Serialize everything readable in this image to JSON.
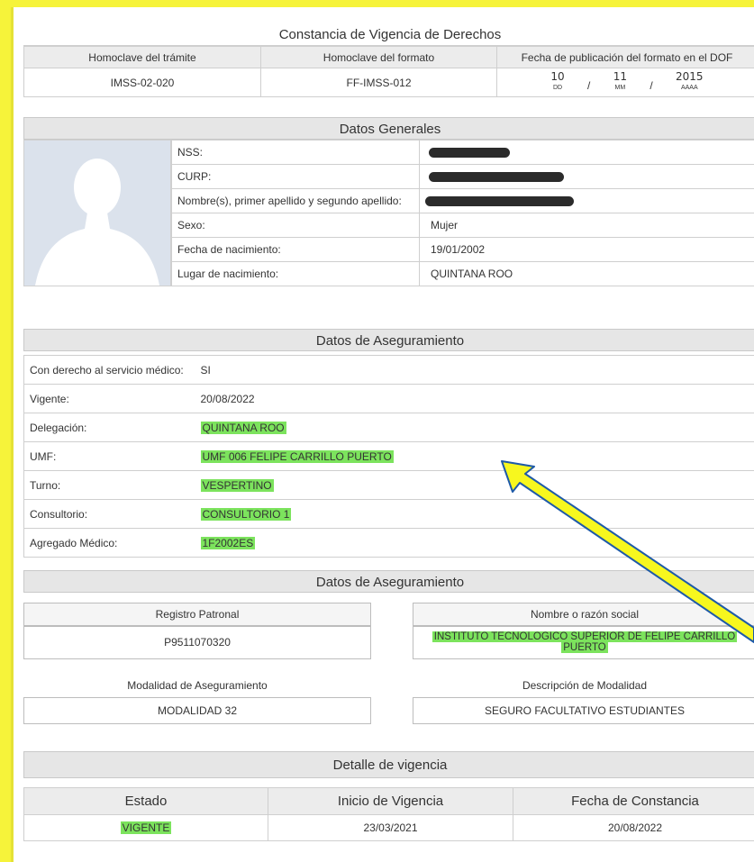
{
  "title": "Constancia de Vigencia de Derechos",
  "tramite": {
    "headers": [
      "Homoclave del trámite",
      "Homoclave del formato",
      "Fecha de publicación del formato en el DOF"
    ],
    "homoclave_tramite": "IMSS-02-020",
    "homoclave_formato": "FF-IMSS-012",
    "fecha": {
      "dd": "10",
      "mm": "11",
      "aaaa": "2015",
      "sep": "/",
      "dd_label": "DD",
      "mm_label": "MM",
      "aaaa_label": "AAAA"
    }
  },
  "datos_generales": {
    "title": "Datos Generales",
    "rows": [
      {
        "label": "NSS:",
        "value": "",
        "redacted": true
      },
      {
        "label": "CURP:",
        "value": "",
        "redacted": true
      },
      {
        "label": "Nombre(s), primer apellido y segundo apellido:",
        "value": "",
        "redacted": true
      },
      {
        "label": "Sexo:",
        "value": "Mujer"
      },
      {
        "label": "Fecha de nacimiento:",
        "value": "19/01/2002"
      },
      {
        "label": "Lugar de nacimiento:",
        "value": "QUINTANA ROO"
      }
    ]
  },
  "aseguramiento": {
    "title": "Datos de Aseguramiento",
    "rows": [
      {
        "label": "Con derecho al servicio médico:",
        "value": "SI",
        "highlight": false
      },
      {
        "label": "Vigente:",
        "value": "20/08/2022",
        "highlight": false
      },
      {
        "label": "Delegación:",
        "value": "QUINTANA ROO",
        "highlight": true
      },
      {
        "label": "UMF:",
        "value": "UMF 006 FELIPE CARRILLO PUERTO",
        "highlight": true
      },
      {
        "label": "Turno:",
        "value": "VESPERTINO",
        "highlight": true
      },
      {
        "label": "Consultorio:",
        "value": "CONSULTORIO 1",
        "highlight": true
      },
      {
        "label": "Agregado Médico:",
        "value": "1F2002ES",
        "highlight": true
      }
    ]
  },
  "patronal": {
    "title": "Datos de Aseguramiento",
    "registro_label": "Registro Patronal",
    "registro_value": "P9511070320",
    "razon_label": "Nombre o razón social",
    "razon_line1": "INSTITUTO TECNOLOGICO SUPERIOR DE FELIPE CARRILLO",
    "razon_line2": "PUERTO",
    "modalidad_label": "Modalidad de Aseguramiento",
    "modalidad_value": "MODALIDAD 32",
    "descripcion_label": "Descripción de Modalidad",
    "descripcion_value": "SEGURO FACULTATIVO ESTUDIANTES"
  },
  "vigencia": {
    "title": "Detalle de vigencia",
    "headers": [
      "Estado",
      "Inicio de Vigencia",
      "Fecha de Constancia"
    ],
    "estado": "VIGENTE",
    "inicio": "23/03/2021",
    "constancia": "20/08/2022"
  },
  "colors": {
    "highlight": "#7ce35d",
    "page_border": "#f6f33a",
    "arrow_fill": "#f7f71e",
    "arrow_stroke": "#1e5aa8"
  }
}
